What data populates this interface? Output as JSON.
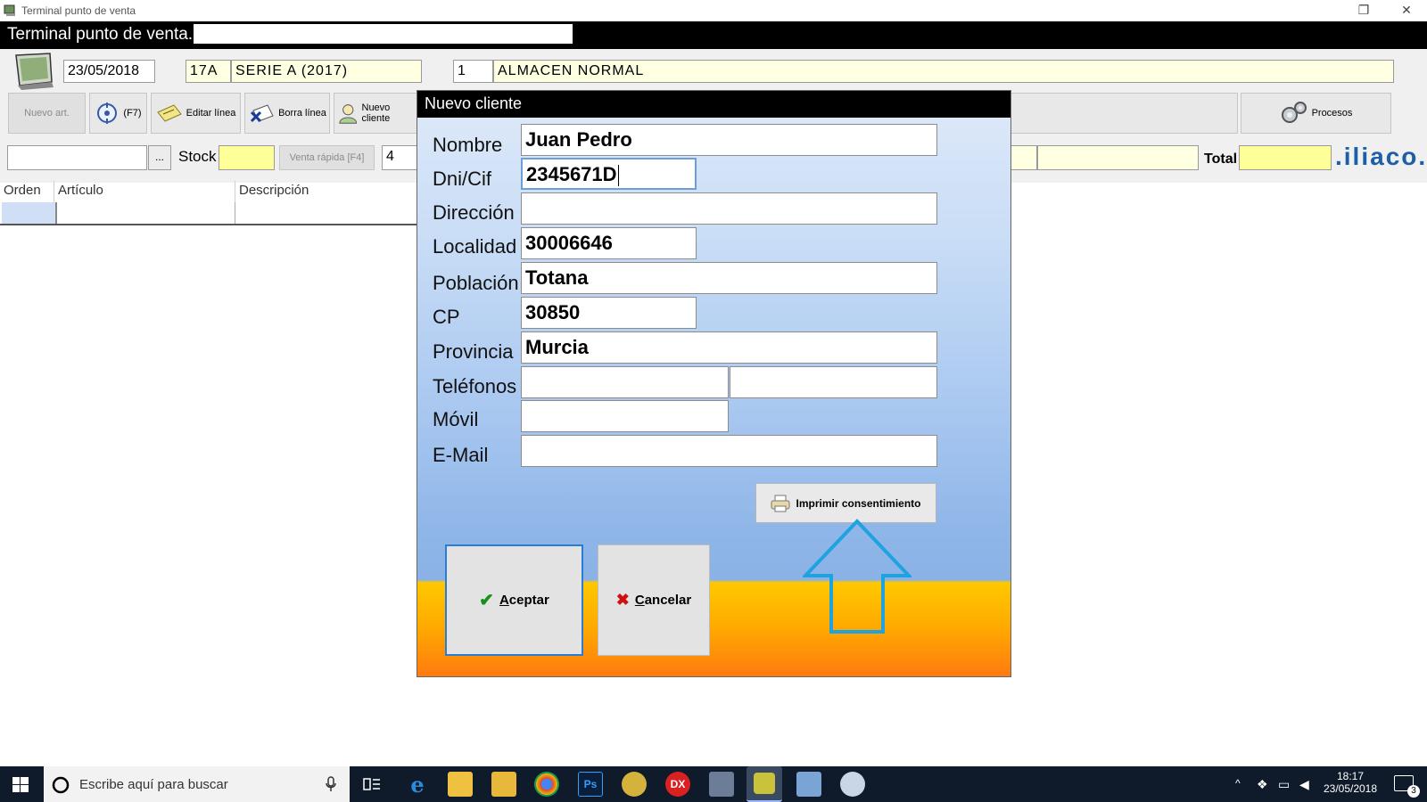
{
  "window": {
    "title": "Terminal punto de venta",
    "restore_symbol": "❐",
    "close_symbol": "✕"
  },
  "header": {
    "label": "Terminal punto de venta.",
    "input_value": ""
  },
  "fields": {
    "date": "23/05/2018",
    "serie_code": "17A",
    "serie_name": "SERIE A (2017)",
    "almacen_code": "1",
    "almacen_name": "ALMACEN NORMAL"
  },
  "toolbar": {
    "nuevo_art": "Nuevo art.",
    "f7": "(F7)",
    "editar_linea": "Editar línea",
    "borra_linea": "Borra línea",
    "nuevo_cliente": "Nuevo cliente",
    "procesos": "Procesos"
  },
  "quickbar": {
    "search_value": "",
    "ellipsis": "...",
    "stock_label": "Stock",
    "stock_value": "",
    "venta_rapida": "Venta rápida [F4]",
    "qty": "4",
    "total_label": "Total",
    "total_value": "",
    "brand": ".iliaco."
  },
  "grid": {
    "columns": [
      "Orden",
      "Artículo",
      "Descripción"
    ]
  },
  "dialog": {
    "title": "Nuevo cliente",
    "labels": {
      "nombre": "Nombre",
      "dni": "Dni/Cif",
      "direccion": "Dirección",
      "localidad": "Localidad",
      "poblacion": "Población",
      "cp": "CP",
      "provincia": "Provincia",
      "telefonos": "Teléfonos",
      "movil": "Móvil",
      "email": "E-Mail"
    },
    "values": {
      "nombre": "Juan Pedro",
      "dni": "2345671D",
      "direccion": "",
      "localidad": "30006646",
      "poblacion": "Totana",
      "cp": "30850",
      "provincia": "Murcia",
      "telefono1": "",
      "telefono2": "",
      "movil": "",
      "email": ""
    },
    "print_button": "Imprimir consentimiento",
    "accept_rest": "ceptar",
    "accept_key": "A",
    "cancel_rest": "ancelar",
    "cancel_key": "C",
    "check_symbol": "✔",
    "cross_symbol": "✖"
  },
  "taskbar": {
    "search_placeholder": "Escribe aquí para buscar",
    "time": "18:17",
    "date": "23/05/2018",
    "notifications": "3",
    "apps": [
      "Ps",
      "DX"
    ]
  },
  "colors": {
    "accent_arrow": "#1fa3e0",
    "accept_border": "#2a7dd4",
    "check_green": "#1a8f1a",
    "cross_red": "#d01010"
  }
}
